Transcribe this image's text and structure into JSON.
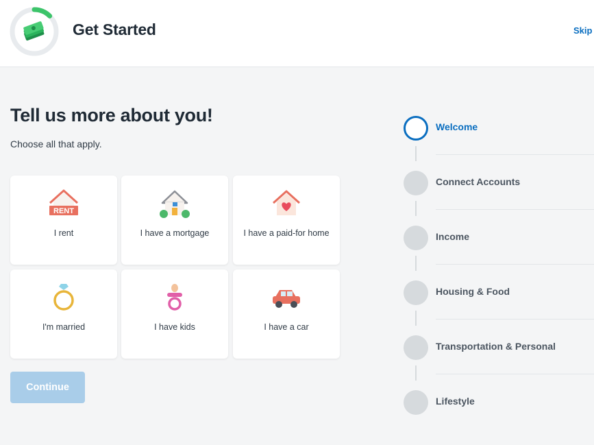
{
  "header": {
    "title": "Get Started",
    "skip_label": "Skip",
    "progress_fraction": 0.12
  },
  "main": {
    "title": "Tell us more about you!",
    "subtitle": "Choose all that apply.",
    "options": [
      {
        "label": "I rent",
        "icon": "house-rent-icon",
        "badge": "RENT"
      },
      {
        "label": "I have a mortgage",
        "icon": "house-mortgage-icon"
      },
      {
        "label": "I have a paid-for home",
        "icon": "house-heart-icon"
      },
      {
        "label": "I'm married",
        "icon": "ring-icon"
      },
      {
        "label": "I have kids",
        "icon": "pacifier-icon"
      },
      {
        "label": "I have a car",
        "icon": "car-icon"
      }
    ],
    "continue_label": "Continue"
  },
  "steps": [
    {
      "label": "Welcome",
      "active": true
    },
    {
      "label": "Connect Accounts",
      "active": false
    },
    {
      "label": "Income",
      "active": false
    },
    {
      "label": "Housing & Food",
      "active": false
    },
    {
      "label": "Transportation & Personal",
      "active": false
    },
    {
      "label": "Lifestyle",
      "active": false
    }
  ],
  "colors": {
    "accent": "#0a6ec0",
    "progress": "#3cc46a",
    "button_disabled": "#a9cde9"
  }
}
